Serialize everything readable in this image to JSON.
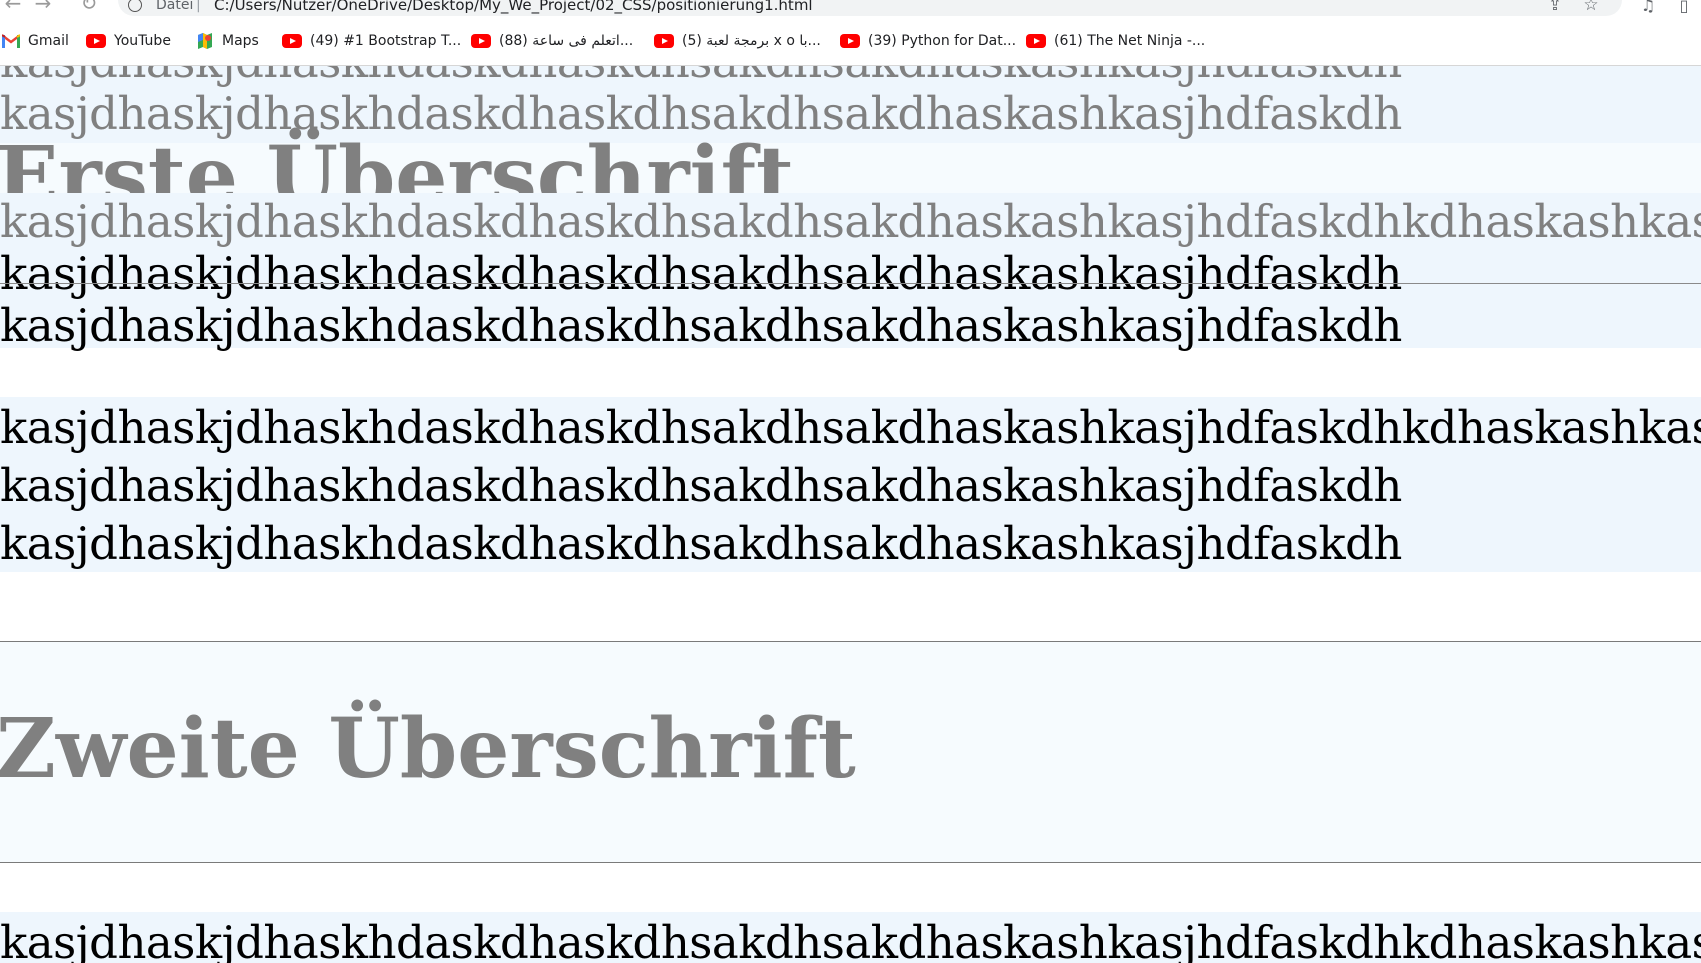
{
  "browser": {
    "site_info_label": "Datei",
    "url": "C:/Users/Nutzer/OneDrive/Desktop/My_We_Project/02_CSS/positionierung1.html",
    "bookmarks": [
      {
        "icon": "gmail-icon",
        "label": "Gmail"
      },
      {
        "icon": "youtube-icon",
        "label": "YouTube"
      },
      {
        "icon": "maps-icon",
        "label": "Maps"
      },
      {
        "icon": "youtube-icon",
        "label": "(49) #1 Bootstrap T..."
      },
      {
        "icon": "youtube-icon",
        "label": "(88) اتعلم فى ساعة..."
      },
      {
        "icon": "youtube-icon",
        "label": "(5) برمجة لعبة x o با..."
      },
      {
        "icon": "youtube-icon",
        "label": "(39) Python for Dat..."
      },
      {
        "icon": "youtube-icon",
        "label": "(61) The Net Ninja -..."
      }
    ]
  },
  "page": {
    "line_short": "kasjdhaskjdhaskhdaskdhaskdhsakdhsakdhaskashkasjhdfaskdh",
    "line_long": "kasjdhaskjdhaskhdaskdhaskdhsakdhsakdhaskashkasjhdfaskdhkdhaskashkasjhdfaskdh",
    "heading1": "Erste Überschrift",
    "heading2": "Zweite Überschrift",
    "colors": {
      "block_bg": "#eef6fd",
      "section_bg": "#f6fbfe",
      "faded_text": "#808080",
      "body_text": "#000000"
    }
  }
}
